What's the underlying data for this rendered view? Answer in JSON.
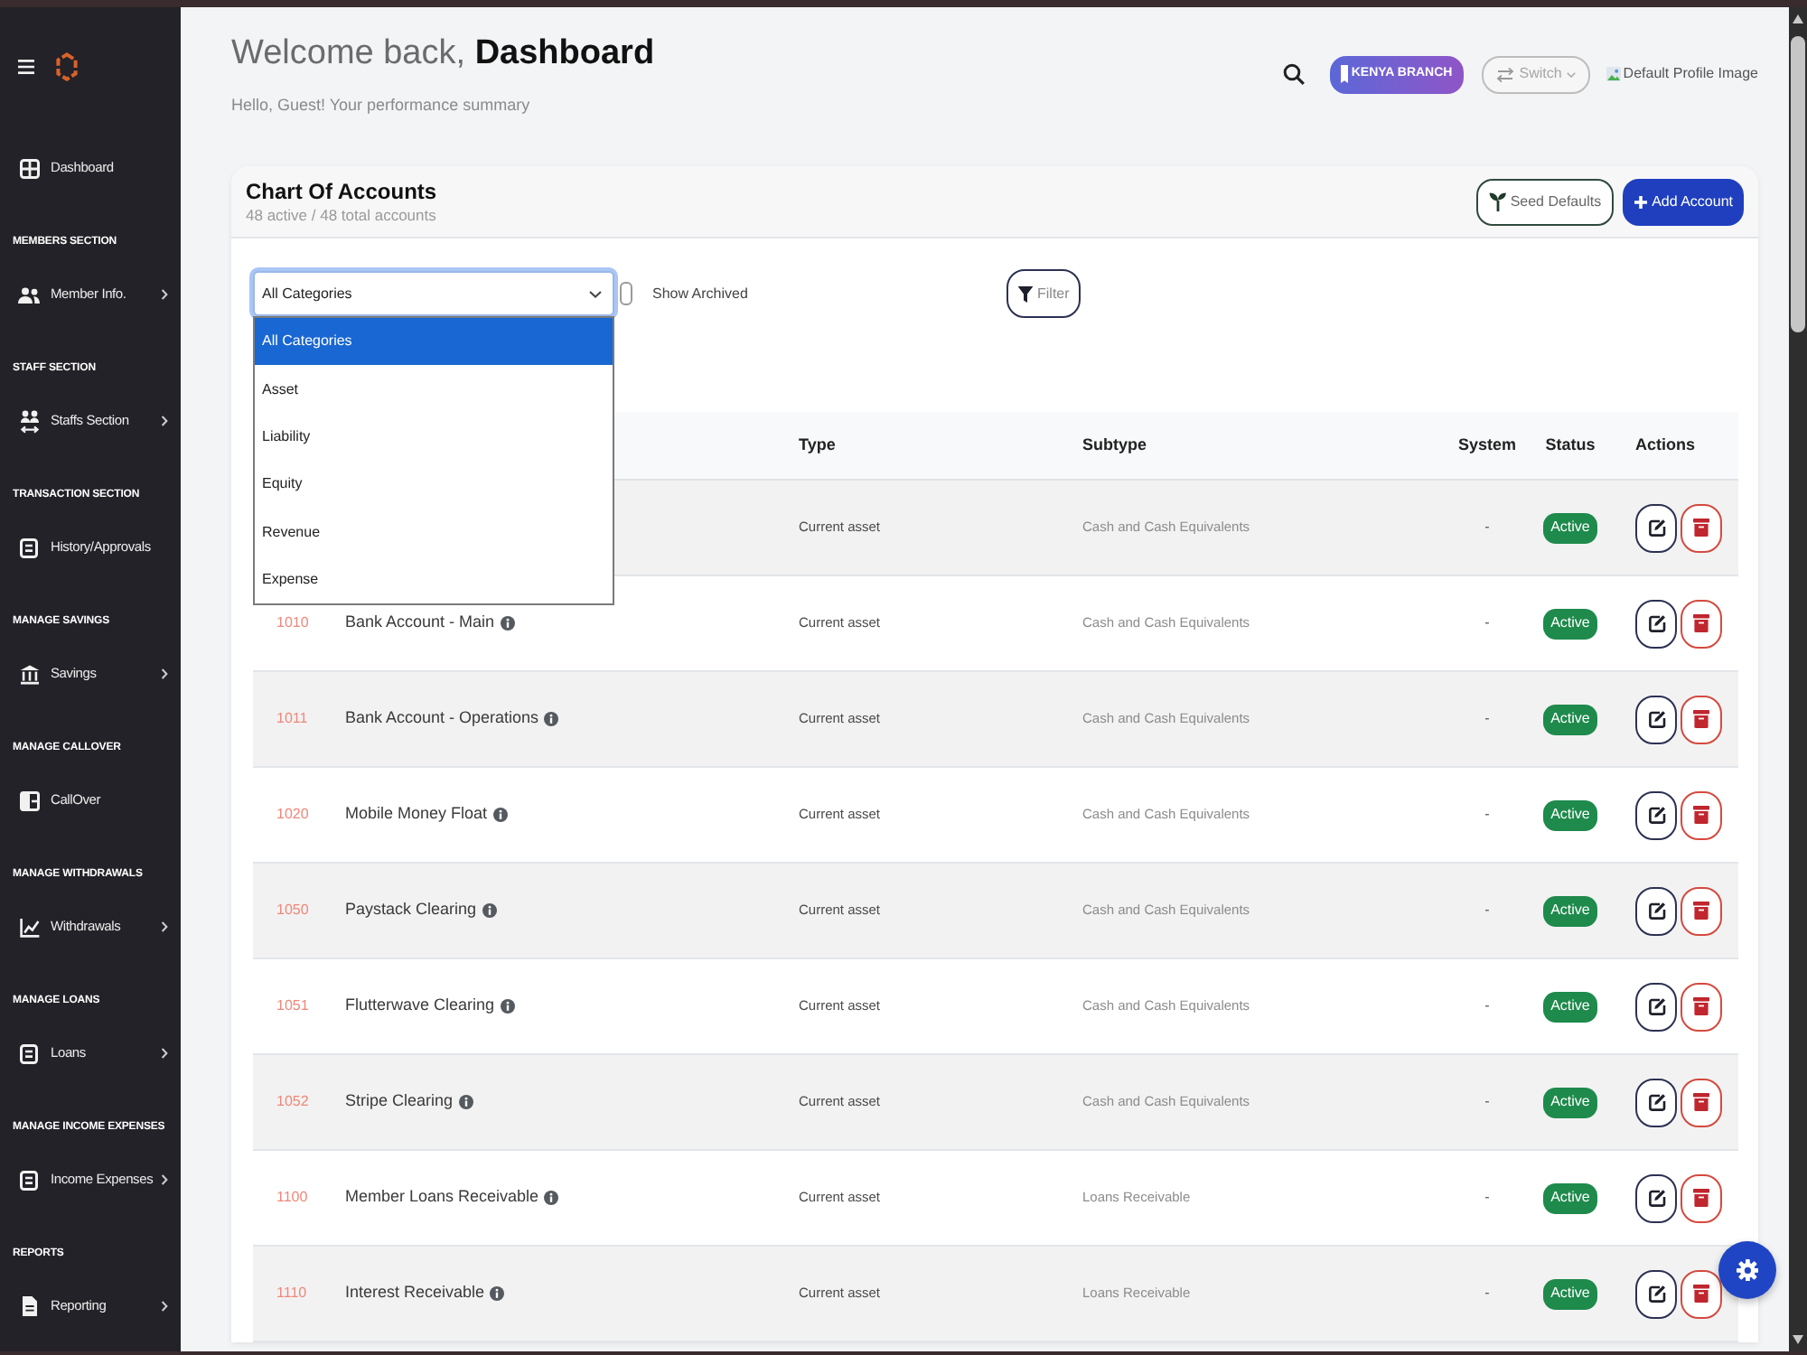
{
  "sidebar": {
    "top_item": {
      "label": "Dashboard",
      "has_submenu": false
    },
    "sections": [
      {
        "heading": "MEMBERS SECTION",
        "items": [
          {
            "label": "Member Info.",
            "has_submenu": true
          }
        ]
      },
      {
        "heading": "STAFF SECTION",
        "items": [
          {
            "label": "Staffs Section",
            "has_submenu": true
          }
        ]
      },
      {
        "heading": "TRANSACTION SECTION",
        "items": [
          {
            "label": "History/Approvals",
            "has_submenu": false
          }
        ]
      },
      {
        "heading": "MANAGE SAVINGS",
        "items": [
          {
            "label": "Savings",
            "has_submenu": true
          }
        ]
      },
      {
        "heading": "MANAGE CALLOVER",
        "items": [
          {
            "label": "CallOver",
            "has_submenu": false
          }
        ]
      },
      {
        "heading": "MANAGE WITHDRAWALS",
        "items": [
          {
            "label": "Withdrawals",
            "has_submenu": true
          }
        ]
      },
      {
        "heading": "MANAGE LOANS",
        "items": [
          {
            "label": "Loans",
            "has_submenu": true
          }
        ]
      },
      {
        "heading": "MANAGE INCOME EXPENSES",
        "items": [
          {
            "label": "Income Expenses",
            "has_submenu": true
          }
        ]
      },
      {
        "heading": "REPORTS",
        "items": [
          {
            "label": "Reporting",
            "has_submenu": true
          }
        ]
      }
    ]
  },
  "header": {
    "greeting": "Welcome back, **Dashboard**",
    "subtitle": "Hello, Guest! Your performance summary",
    "branch": "KENYA BRANCH",
    "switch": "Switch",
    "profile_image_alt": "Default Profile Image"
  },
  "card": {
    "title": "Chart Of Accounts",
    "subtitle": "48 active / 48 total accounts",
    "buttons": [
      {
        "label": "Seed Defaults",
        "kind": "outline"
      },
      {
        "label": "Add Account",
        "kind": "primary"
      }
    ],
    "filters": {
      "category_select": {
        "value": "All Categories",
        "expanded": true,
        "options": [
          {
            "label": "All Categories",
            "selected": true
          },
          {
            "label": "Asset",
            "selected": false
          },
          {
            "label": "Liability",
            "selected": false
          },
          {
            "label": "Equity",
            "selected": false
          },
          {
            "label": "Revenue",
            "selected": false
          },
          {
            "label": "Expense",
            "selected": false
          }
        ]
      },
      "show_archived": {
        "label": "Show Archived",
        "checked": false
      },
      "filter_button": "Filter"
    },
    "table": {
      "columns": [
        "Type",
        "Subtype",
        "System",
        "Status",
        "Actions"
      ],
      "rows": [
        {
          "type": "Current asset",
          "subtype": "Cash and Cash Equivalents",
          "system": "-",
          "status": "Active"
        },
        {
          "code": "1010",
          "name": "Bank Account - Main",
          "type": "Current asset",
          "subtype": "Cash and Cash Equivalents",
          "system": "-",
          "status": "Active"
        },
        {
          "code": "1011",
          "name": "Bank Account - Operations",
          "type": "Current asset",
          "subtype": "Cash and Cash Equivalents",
          "system": "-",
          "status": "Active"
        },
        {
          "code": "1020",
          "name": "Mobile Money Float",
          "type": "Current asset",
          "subtype": "Cash and Cash Equivalents",
          "system": "-",
          "status": "Active"
        },
        {
          "code": "1050",
          "name": "Paystack Clearing",
          "type": "Current asset",
          "subtype": "Cash and Cash Equivalents",
          "system": "-",
          "status": "Active"
        },
        {
          "code": "1051",
          "name": "Flutterwave Clearing",
          "type": "Current asset",
          "subtype": "Cash and Cash Equivalents",
          "system": "-",
          "status": "Active"
        },
        {
          "code": "1052",
          "name": "Stripe Clearing",
          "type": "Current asset",
          "subtype": "Cash and Cash Equivalents",
          "system": "-",
          "status": "Active"
        },
        {
          "code": "1100",
          "name": "Member Loans Receivable",
          "type": "Current asset",
          "subtype": "Loans Receivable",
          "system": "-",
          "status": "Active"
        },
        {
          "code": "1110",
          "name": "Interest Receivable",
          "type": "Current asset",
          "subtype": "Loans Receivable",
          "system": "-",
          "status": "Active"
        }
      ]
    }
  }
}
